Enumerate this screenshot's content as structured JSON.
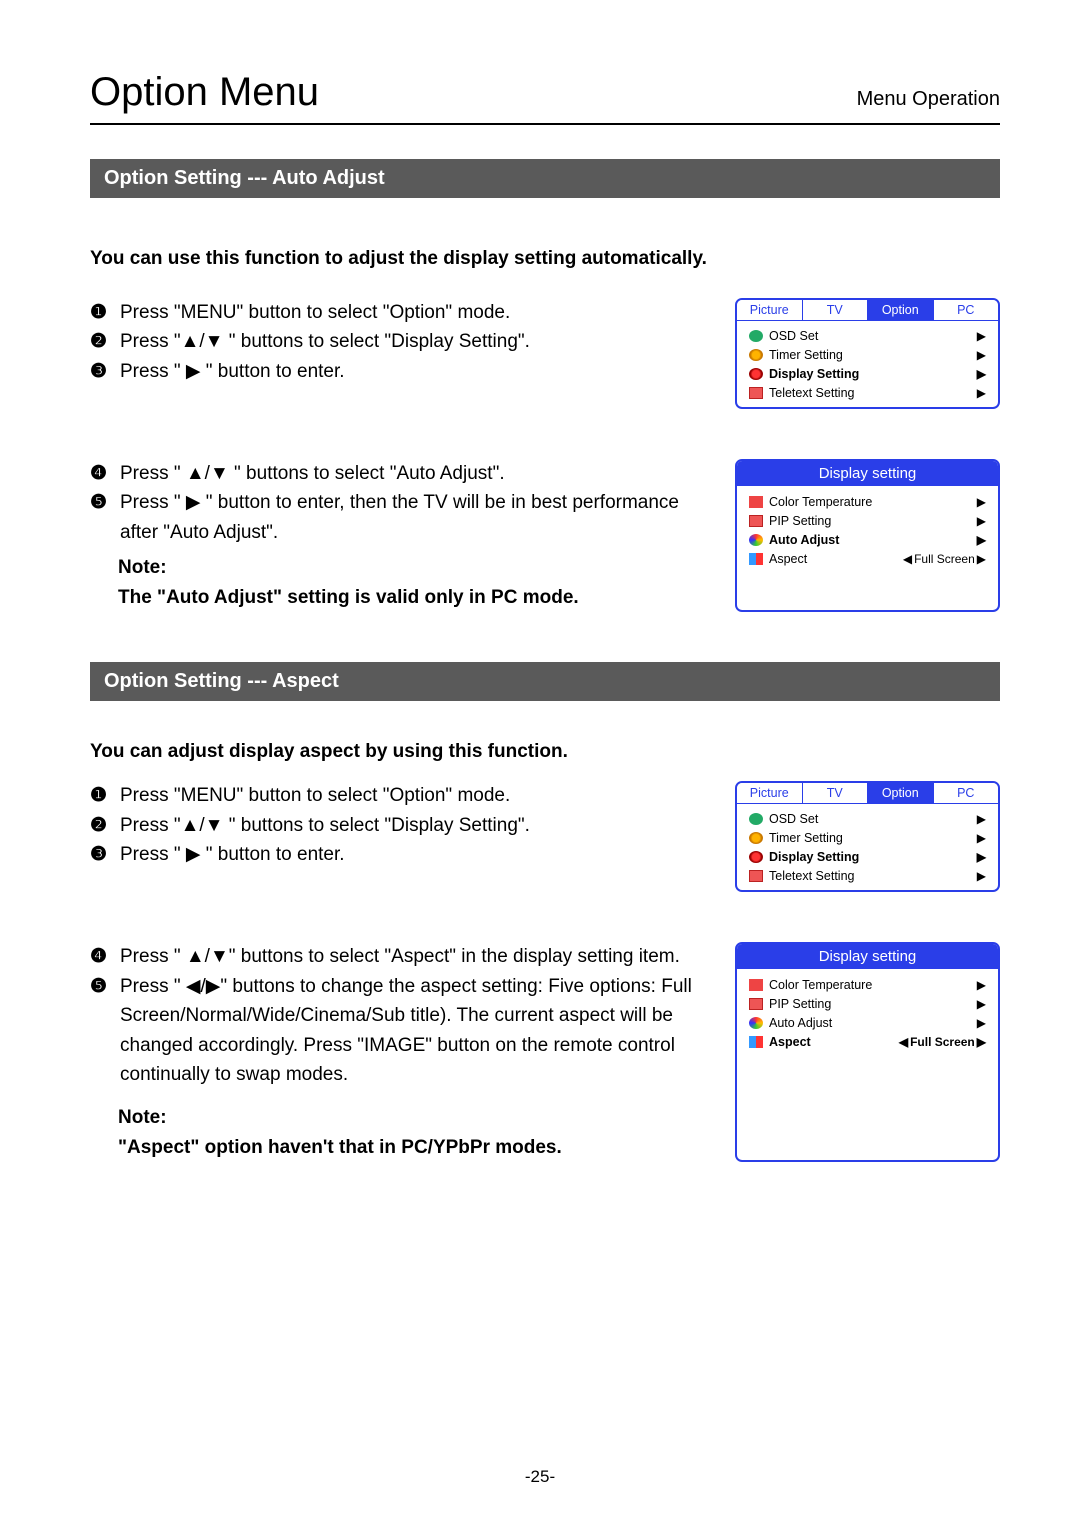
{
  "header": {
    "title": "Option Menu",
    "subtitle": "Menu Operation"
  },
  "page_number": "-25-",
  "sec1": {
    "heading": "Option Setting --- Auto Adjust",
    "intro": "You can use this function to adjust the display setting automatically.",
    "stepsA": [
      "Press \"MENU\" button to select \"Option\" mode.",
      "Press \"▲/▼ \" buttons to select \"Display Setting\".",
      "Press \" ▶ \" button to enter."
    ],
    "stepsB": [
      "Press \" ▲/▼ \" buttons to select \"Auto Adjust\".",
      "Press \" ▶ \" button to enter, then the TV will be in best performance after \"Auto Adjust\"."
    ],
    "note_label": "Note:",
    "note_text": "The \"Auto Adjust\" setting is valid only in PC mode."
  },
  "sec2": {
    "heading": "Option Setting --- Aspect",
    "intro": "You can adjust display aspect by using this function.",
    "stepsA": [
      "Press \"MENU\" button to select \"Option\" mode.",
      "Press \"▲/▼ \" buttons to select \"Display Setting\".",
      "Press \" ▶ \" button to enter."
    ],
    "stepsB": [
      "Press \" ▲/▼\" buttons to select \"Aspect\" in the display setting item.",
      "Press \" ◀/▶\" buttons to change the aspect setting: Five options: Full Screen/Normal/Wide/Cinema/Sub title). The current aspect will be changed accordingly. Press \"IMAGE\" button on the remote control continually to swap modes."
    ],
    "note_label": "Note:",
    "note_text": "\"Aspect\" option haven't that in PC/YPbPr modes."
  },
  "osd_main": {
    "tabs": [
      "Picture",
      "TV",
      "Option",
      "PC"
    ],
    "active_tab": "Option",
    "rows": [
      {
        "label": "OSD Set"
      },
      {
        "label": "Timer Setting"
      },
      {
        "label": "Display Setting",
        "bold": true
      },
      {
        "label": "Teletext Setting"
      }
    ]
  },
  "osd_sub1": {
    "title": "Display setting",
    "rows": [
      {
        "label": "Color Temperature"
      },
      {
        "label": "PIP Setting"
      },
      {
        "label": "Auto Adjust",
        "bold": true
      },
      {
        "label": "Aspect",
        "value": "Full Screen"
      }
    ]
  },
  "osd_sub2": {
    "title": "Display setting",
    "rows": [
      {
        "label": "Color Temperature"
      },
      {
        "label": "PIP Setting"
      },
      {
        "label": "Auto Adjust"
      },
      {
        "label": "Aspect",
        "bold": true,
        "value": "Full Screen"
      }
    ]
  }
}
